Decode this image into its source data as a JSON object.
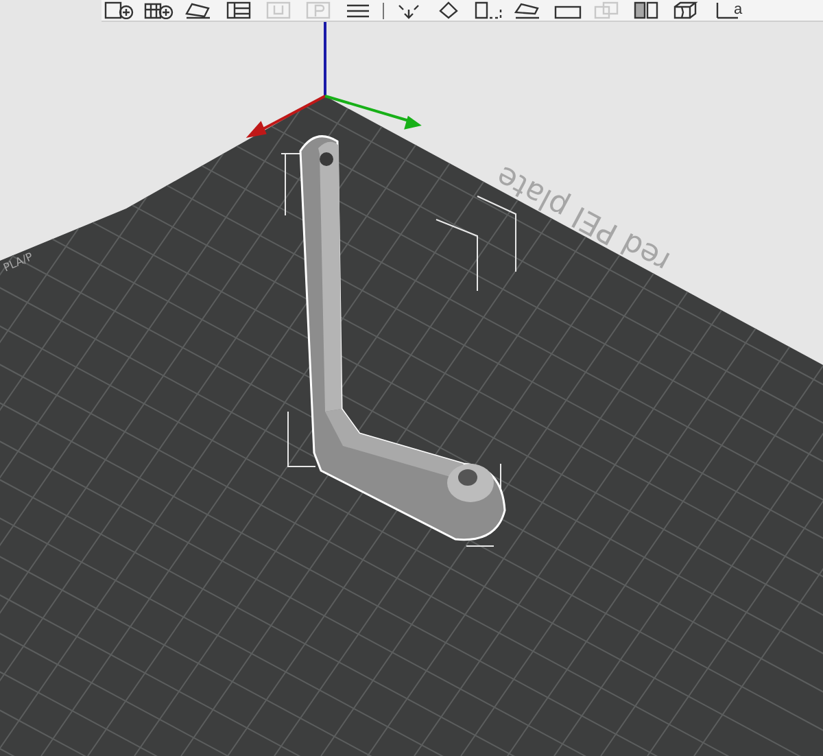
{
  "toolbar": {
    "buttons": [
      {
        "kind": "add",
        "disabled": false
      },
      {
        "kind": "add-instance",
        "disabled": false
      },
      {
        "kind": "arrange",
        "disabled": false
      },
      {
        "kind": "layout",
        "disabled": false
      },
      {
        "kind": "undo",
        "disabled": true
      },
      {
        "kind": "paste",
        "disabled": true
      },
      {
        "kind": "menu",
        "disabled": false
      },
      {
        "kind": "separator"
      },
      {
        "kind": "move",
        "disabled": false
      },
      {
        "kind": "rotate",
        "disabled": false
      },
      {
        "kind": "scale",
        "disabled": false
      },
      {
        "kind": "face",
        "disabled": false
      },
      {
        "kind": "cut",
        "disabled": false
      },
      {
        "kind": "copy",
        "disabled": true
      },
      {
        "kind": "supports",
        "disabled": false
      },
      {
        "kind": "seam",
        "disabled": false
      },
      {
        "kind": "text",
        "disabled": false,
        "label": "a"
      }
    ]
  },
  "bed": {
    "labels": [
      {
        "kind": "plate",
        "text": "red PEI plate"
      },
      {
        "kind": "badge",
        "text": "PLA/P"
      }
    ]
  }
}
